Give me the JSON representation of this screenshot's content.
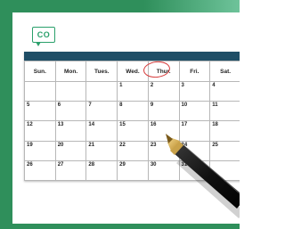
{
  "logo": {
    "text": "CO"
  },
  "calendar": {
    "weekdays": [
      "Sun.",
      "Mon.",
      "Tues.",
      "Wed.",
      "Thur.",
      "Fri.",
      "Sat."
    ],
    "rows": [
      [
        "",
        "",
        "",
        "1",
        "2",
        "3",
        "4"
      ],
      [
        "5",
        "6",
        "7",
        "8",
        "9",
        "10",
        "11"
      ],
      [
        "12",
        "13",
        "14",
        "15",
        "16",
        "17",
        "18"
      ],
      [
        "19",
        "20",
        "21",
        "22",
        "23",
        "24",
        "25"
      ],
      [
        "26",
        "27",
        "28",
        "29",
        "30",
        "31",
        ""
      ]
    ],
    "highlighted_day": "Thur.",
    "weekend_color": "#d84a4a",
    "header_bar_color": "#1f4e66"
  },
  "colors": {
    "brand_green": "#2f8f5b",
    "logo_green": "#2aa06b",
    "circle_red": "#d63a3a"
  }
}
